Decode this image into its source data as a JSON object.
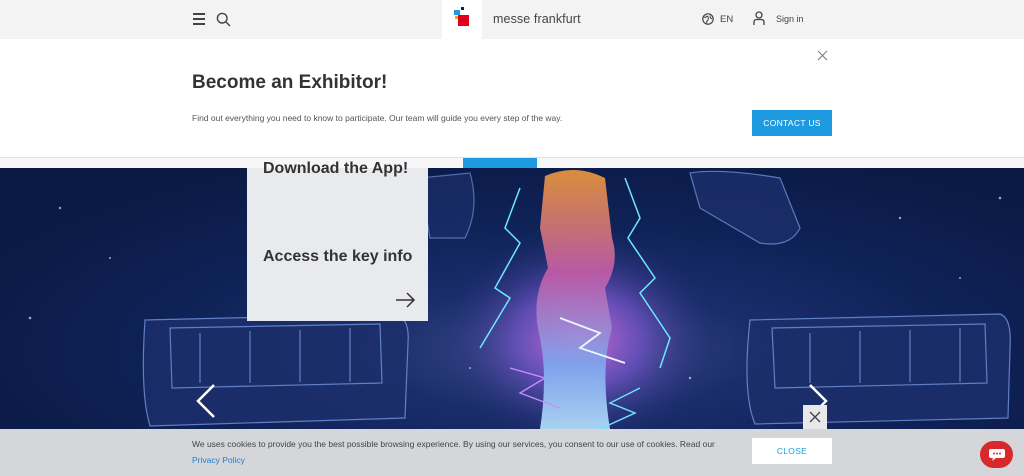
{
  "header": {
    "logo_text": "messe frankfurt",
    "lang": "EN",
    "signin": "Sign in",
    "logo_colors": [
      "#1e9be0",
      "#e2001a",
      "#f7a600",
      "#1a1a6c"
    ]
  },
  "exhibitor": {
    "title": "Become an Exhibitor!",
    "description": "Find out everything you need to know to participate. Our team will guide you every step of the way.",
    "button": "CONTACT US"
  },
  "hero": {
    "card": {
      "item1": "Download the App!",
      "item2": "Access the key info"
    }
  },
  "cookie": {
    "text": "We uses cookies to provide you the best possible browsing experience. By using our services, you consent to our use of cookies. Read our",
    "link": "Privacy Policy",
    "button": "CLOSE"
  },
  "colors": {
    "accent": "#1e9be0",
    "chat": "#d9282b"
  }
}
